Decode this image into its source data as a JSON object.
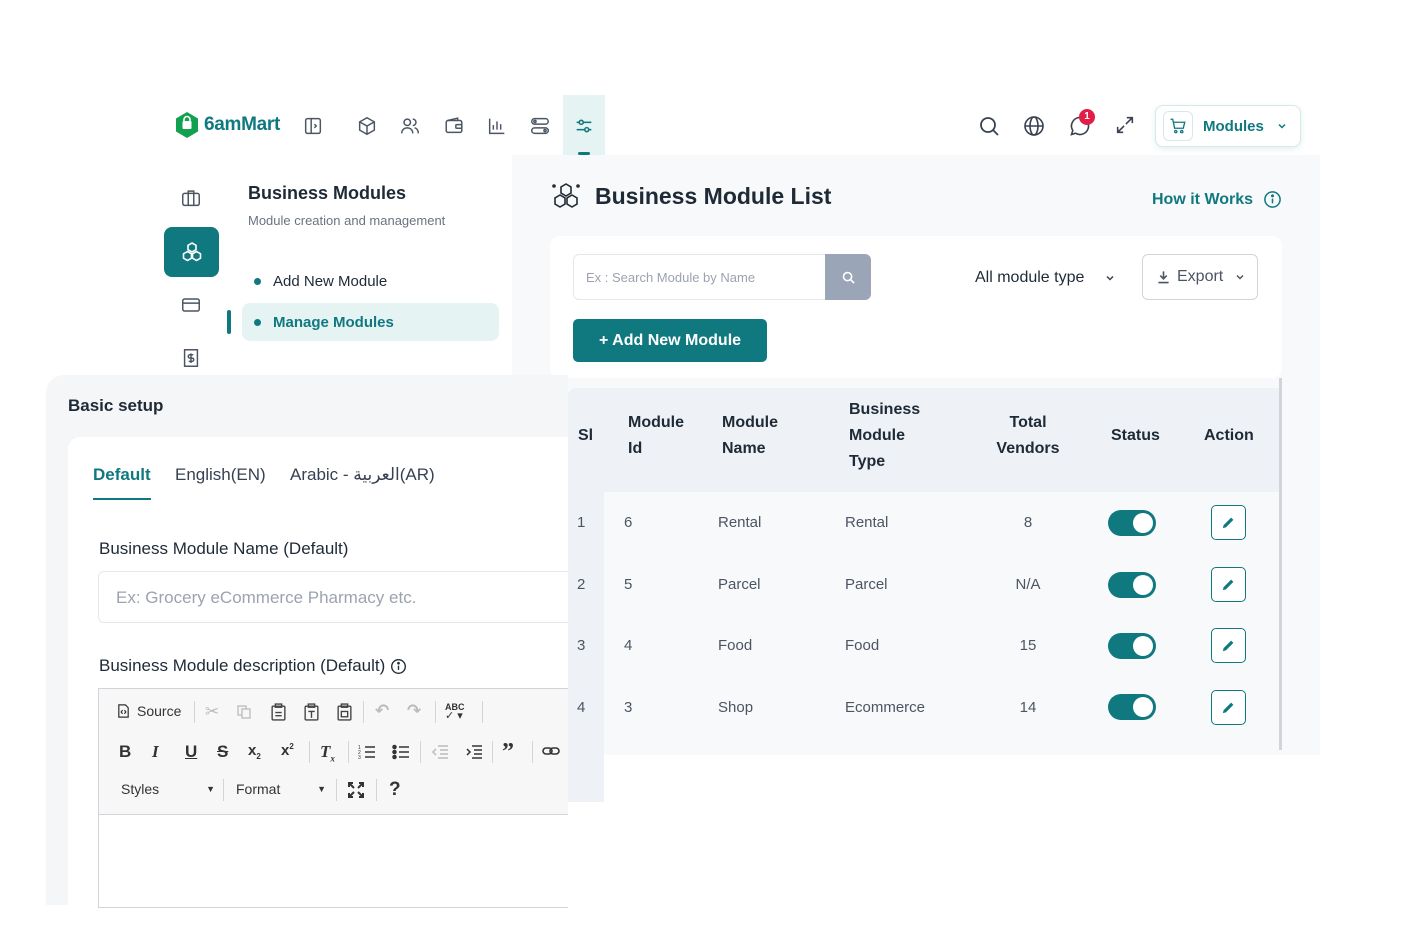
{
  "brand": {
    "name": "6amMart",
    "color": "#107980"
  },
  "topbar": {
    "notification_count": "1",
    "modules_label": "Modules"
  },
  "submenu": {
    "title": "Business Modules",
    "description": "Module creation and management",
    "items": [
      {
        "label": "Add New Module",
        "active": false
      },
      {
        "label": "Manage Modules",
        "active": true
      }
    ]
  },
  "main": {
    "title": "Business Module List",
    "how_it_works": "How it Works",
    "search": {
      "placeholder": "Ex : Search Module by Name"
    },
    "module_type_select": "All module type",
    "export_label": "Export",
    "add_button_label": "+ Add New Module"
  },
  "table": {
    "headers": {
      "si": "Sl",
      "module_id": [
        "Module",
        "Id"
      ],
      "module_name": [
        "Module",
        "Name"
      ],
      "module_type": [
        "Business",
        "Module",
        "Type"
      ],
      "vendors": [
        "Total",
        "Vendors"
      ],
      "status": "Status",
      "action": "Action"
    },
    "rows": [
      {
        "si": "1",
        "id": "6",
        "name": "Rental",
        "type": "Rental",
        "vendors": "8",
        "status": true
      },
      {
        "si": "2",
        "id": "5",
        "name": "Parcel",
        "type": "Parcel",
        "vendors": "N/A",
        "status": true
      },
      {
        "si": "3",
        "id": "4",
        "name": "Food",
        "type": "Food",
        "vendors": "15",
        "status": true
      },
      {
        "si": "4",
        "id": "3",
        "name": "Shop",
        "type": "Ecommerce",
        "vendors": "14",
        "status": true
      }
    ]
  },
  "setup": {
    "title": "Basic setup",
    "tabs": [
      "Default",
      "English(EN)",
      "Arabic - العربية(AR)"
    ],
    "name_label": "Business Module Name (Default)",
    "name_placeholder": "Ex: Grocery eCommerce Pharmacy etc.",
    "description_label": "Business Module description (Default)",
    "editor": {
      "source_label": "Source",
      "styles_label": "Styles",
      "format_label": "Format",
      "help_label": "?"
    }
  }
}
